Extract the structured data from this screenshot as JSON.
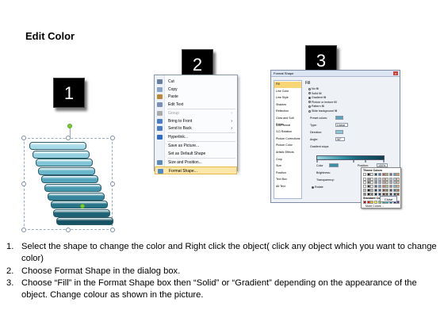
{
  "title": "Edit Color",
  "steps": [
    "1",
    "2",
    "3"
  ],
  "bar_colors": [
    "#a8dbe9",
    "#94d0df",
    "#7fc4d6",
    "#6ab6cb",
    "#56a6bd",
    "#4597ae",
    "#35869d",
    "#277489",
    "#1d6375",
    "#155263"
  ],
  "menu": {
    "items": [
      {
        "label": "Cut",
        "icon": "scissors-icon",
        "disabled": false,
        "submenu": false
      },
      {
        "label": "Copy",
        "icon": "copy-icon",
        "disabled": false,
        "submenu": false
      },
      {
        "label": "Paste",
        "icon": "paste-icon",
        "disabled": false,
        "submenu": false
      },
      {
        "label": "Edit Text",
        "icon": "edit-text-icon",
        "disabled": false,
        "submenu": false
      },
      {
        "label": "Group",
        "icon": "group-icon",
        "disabled": true,
        "submenu": true
      },
      {
        "label": "Bring to Front",
        "icon": "bring-front-icon",
        "disabled": false,
        "submenu": true
      },
      {
        "label": "Send to Back",
        "icon": "send-back-icon",
        "disabled": false,
        "submenu": true
      },
      {
        "label": "Hyperlink...",
        "icon": "hyperlink-icon",
        "disabled": false,
        "submenu": false
      },
      {
        "label": "Save as Picture...",
        "icon": "",
        "disabled": false,
        "submenu": false
      },
      {
        "label": "Set as Default Shape",
        "icon": "",
        "disabled": false,
        "submenu": false
      },
      {
        "label": "Size and Position...",
        "icon": "size-position-icon",
        "disabled": false,
        "submenu": false
      },
      {
        "label": "Format Shape...",
        "icon": "format-shape-icon",
        "disabled": false,
        "submenu": false,
        "selected": true
      }
    ]
  },
  "dialog": {
    "title": "Format Shape",
    "nav": [
      "Fill",
      "Line Color",
      "Line Style",
      "Shadow",
      "Reflection",
      "Glow and Soft Edges",
      "3-D Format",
      "3-D Rotation",
      "Picture Corrections",
      "Picture Color",
      "Artistic Effects",
      "Crop",
      "Size",
      "Position",
      "Text Box",
      "Alt Text"
    ],
    "pane_title": "Fill",
    "fill_options": [
      "No fill",
      "Solid fill",
      "Gradient fill",
      "Picture or texture fill",
      "Pattern fill",
      "Slide background fill"
    ],
    "selected_fill": 2,
    "preset_colors_label": "Preset colors:",
    "type_label": "Type:",
    "type_value": "Linear",
    "direction_label": "Direction:",
    "angle_label": "Angle:",
    "angle_value": "90°",
    "gradient_stops_label": "Gradient stops",
    "color_label": "Color",
    "position_label": "Position:",
    "position_value": "100%",
    "brightness_label": "Brightness:",
    "transparency_label": "Transparency:",
    "rotate_label": "Rotate",
    "theme_colors_label": "Theme Colors",
    "standard_colors_label": "Standard Colors",
    "more_colors_label": "More Colors...",
    "close_label": "Close",
    "theme_colors": [
      "#ffffff",
      "#000000",
      "#eeece1",
      "#1f497d",
      "#4f81bd",
      "#c0504d",
      "#9bbb59",
      "#8064a2",
      "#4bacc6",
      "#f79646"
    ],
    "standard_colors": [
      "#c00000",
      "#ff0000",
      "#ffc000",
      "#ffff00",
      "#92d050",
      "#00b050",
      "#00b0f0",
      "#0070c0",
      "#002060",
      "#7030a0"
    ]
  },
  "instructions": [
    {
      "num": "1.",
      "text": "Select the shape to change the color and Right click the object( click any object which you want to change color)"
    },
    {
      "num": "2.",
      "text": "Choose Format Shape in the dialog box."
    },
    {
      "num": "3.",
      "text": "Choose “Fill” in the Format Shape box then “Solid” or “Gradient” depending on the appearance of the object. Change colour as shown in the picture."
    }
  ]
}
